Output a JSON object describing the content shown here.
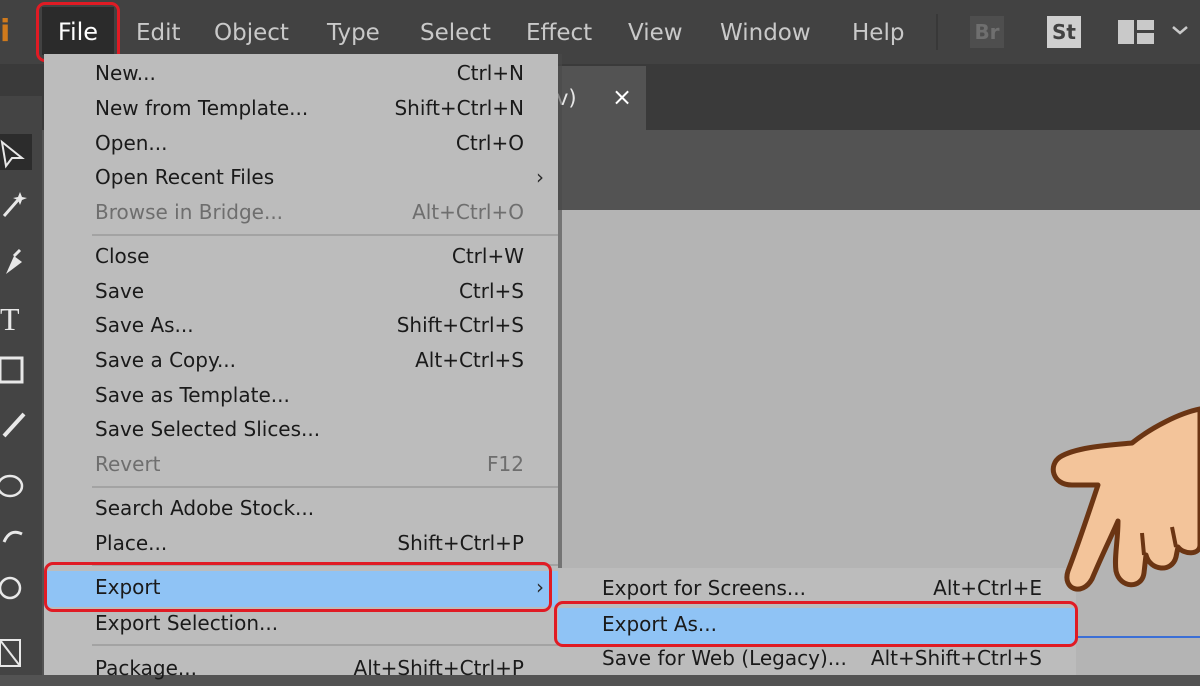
{
  "app": {
    "logo_text": "i"
  },
  "menubar": {
    "items": [
      "File",
      "Edit",
      "Object",
      "Type",
      "Select",
      "Effect",
      "View",
      "Window",
      "Help"
    ],
    "apps": {
      "bridge": "Br",
      "stock": "St"
    }
  },
  "document_tab": {
    "title_fragment": "v)",
    "close": "×"
  },
  "file_menu": {
    "items": [
      {
        "label": "New...",
        "shortcut": "Ctrl+N"
      },
      {
        "label": "New from Template...",
        "shortcut": "Shift+Ctrl+N"
      },
      {
        "label": "Open...",
        "shortcut": "Ctrl+O"
      },
      {
        "label": "Open Recent Files",
        "shortcut": "",
        "arrow": "›"
      },
      {
        "label": "Browse in Bridge...",
        "shortcut": "Alt+Ctrl+O",
        "disabled": true
      },
      {
        "label": "Close",
        "shortcut": "Ctrl+W"
      },
      {
        "label": "Save",
        "shortcut": "Ctrl+S"
      },
      {
        "label": "Save As...",
        "shortcut": "Shift+Ctrl+S"
      },
      {
        "label": "Save a Copy...",
        "shortcut": "Alt+Ctrl+S"
      },
      {
        "label": "Save as Template...",
        "shortcut": ""
      },
      {
        "label": "Save Selected Slices...",
        "shortcut": ""
      },
      {
        "label": "Revert",
        "shortcut": "F12",
        "disabled": true
      },
      {
        "label": "Search Adobe Stock...",
        "shortcut": ""
      },
      {
        "label": "Place...",
        "shortcut": "Shift+Ctrl+P"
      },
      {
        "label": "Export",
        "shortcut": "",
        "arrow": "›"
      },
      {
        "label": "Export Selection...",
        "shortcut": ""
      },
      {
        "label": "Package...",
        "shortcut": "Alt+Shift+Ctrl+P"
      }
    ]
  },
  "export_submenu": {
    "items": [
      {
        "label": "Export for Screens...",
        "shortcut": "Alt+Ctrl+E"
      },
      {
        "label": "Export As...",
        "shortcut": ""
      },
      {
        "label": "Save for Web (Legacy)...",
        "shortcut": "Alt+Shift+Ctrl+S"
      }
    ]
  },
  "colors": {
    "highlight": "#8fc3f5",
    "annotation": "#e01b24",
    "menu_bg": "#bcbcbc",
    "menubar_bg": "#424242"
  },
  "icons": [
    "selection-tool-icon",
    "magic-wand-icon",
    "pen-tool-icon",
    "type-tool-icon",
    "rectangle-tool-icon",
    "paintbrush-icon",
    "lasso-icon",
    "rotate-icon",
    "zoom-tool-icon",
    "artboard-icon",
    "pointing-hand-icon"
  ]
}
